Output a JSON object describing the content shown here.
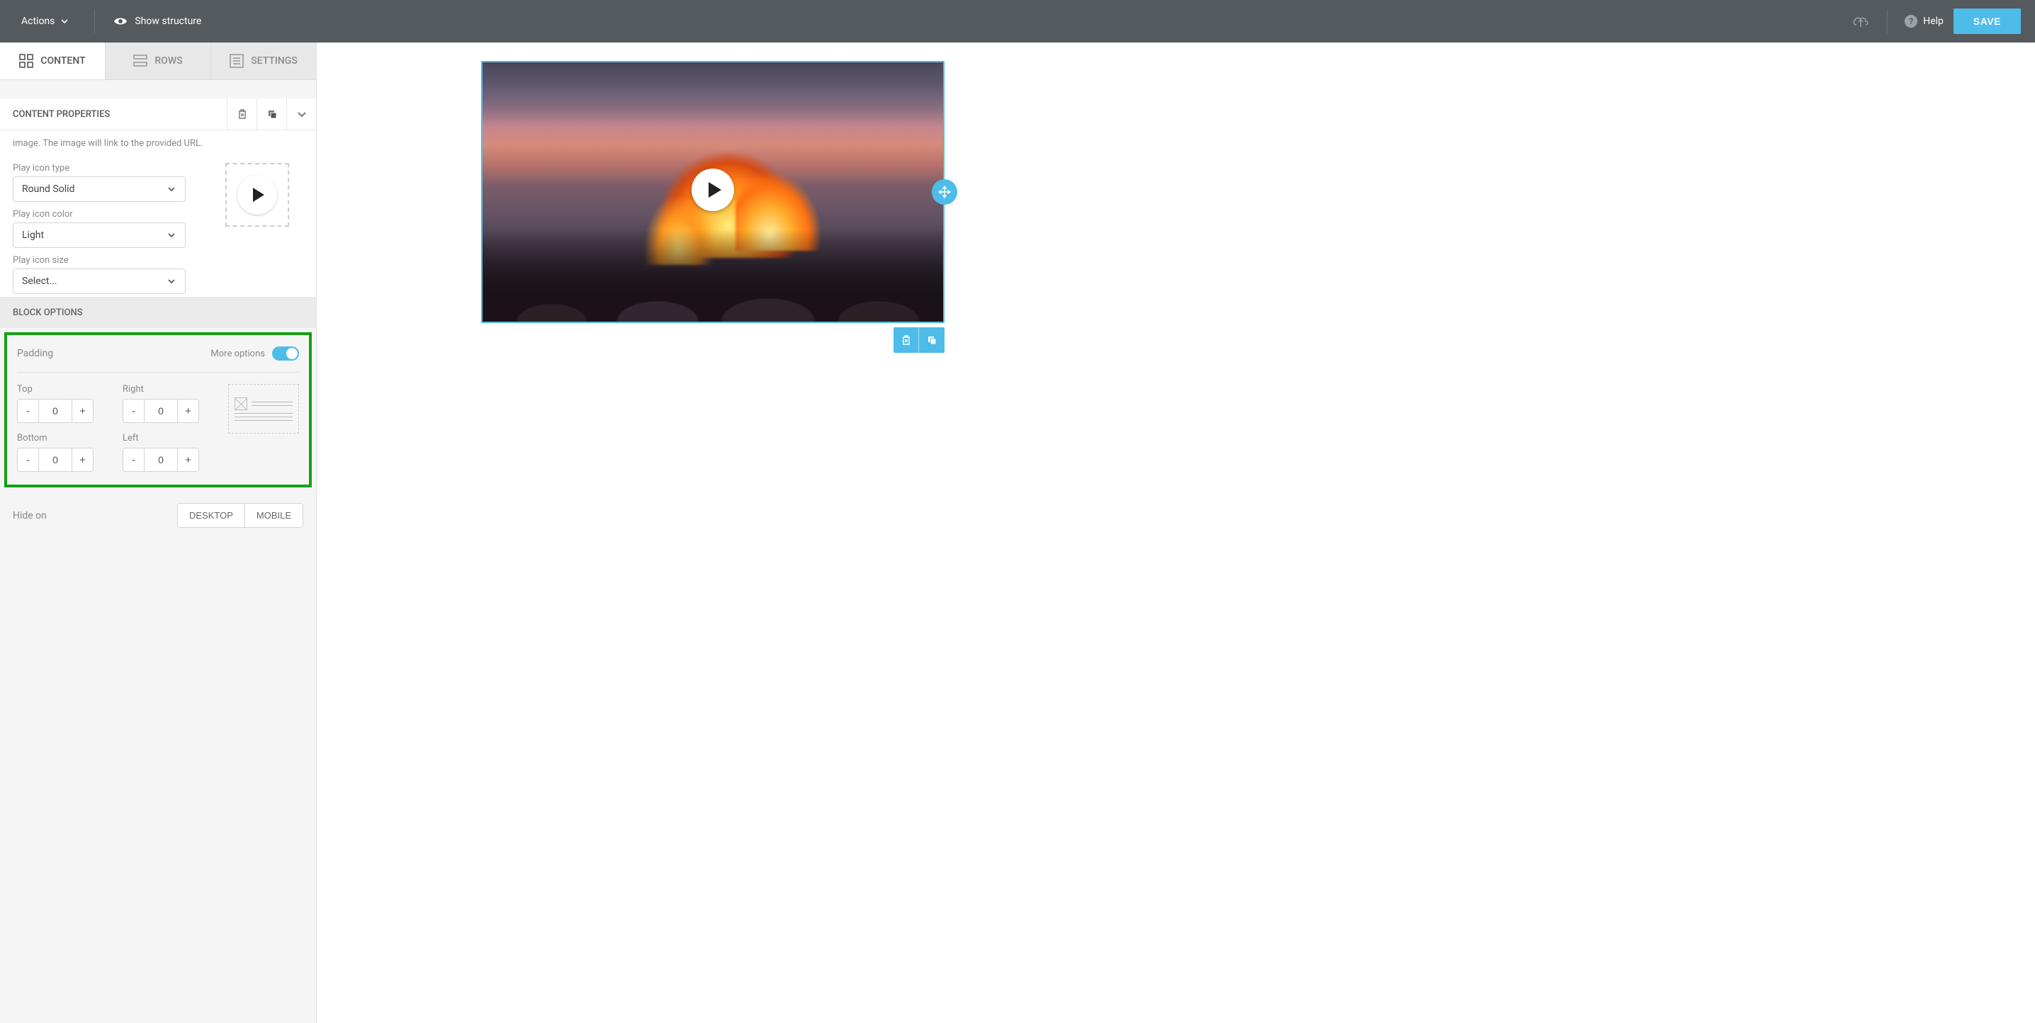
{
  "topbar": {
    "actions_label": "Actions",
    "show_structure_label": "Show structure",
    "help_label": "Help",
    "save_label": "SAVE"
  },
  "tabs": {
    "content": "CONTENT",
    "rows": "ROWS",
    "settings": "SETTINGS"
  },
  "properties": {
    "header": "CONTENT PROPERTIES",
    "description_fragment": "image. The image will link to the provided URL.",
    "play_icon_type_label": "Play icon type",
    "play_icon_type_value": "Round Solid",
    "play_icon_color_label": "Play icon color",
    "play_icon_color_value": "Light",
    "play_icon_size_label": "Play icon size",
    "play_icon_size_value": "Select..."
  },
  "block_options": {
    "header": "BLOCK OPTIONS",
    "padding_label": "Padding",
    "more_options_label": "More options",
    "top_label": "Top",
    "right_label": "Right",
    "bottom_label": "Bottom",
    "left_label": "Left",
    "top_value": "0",
    "right_value": "0",
    "bottom_value": "0",
    "left_value": "0",
    "minus": "-",
    "plus": "+"
  },
  "hide_on": {
    "label": "Hide on",
    "desktop": "DESKTOP",
    "mobile": "MOBILE"
  }
}
